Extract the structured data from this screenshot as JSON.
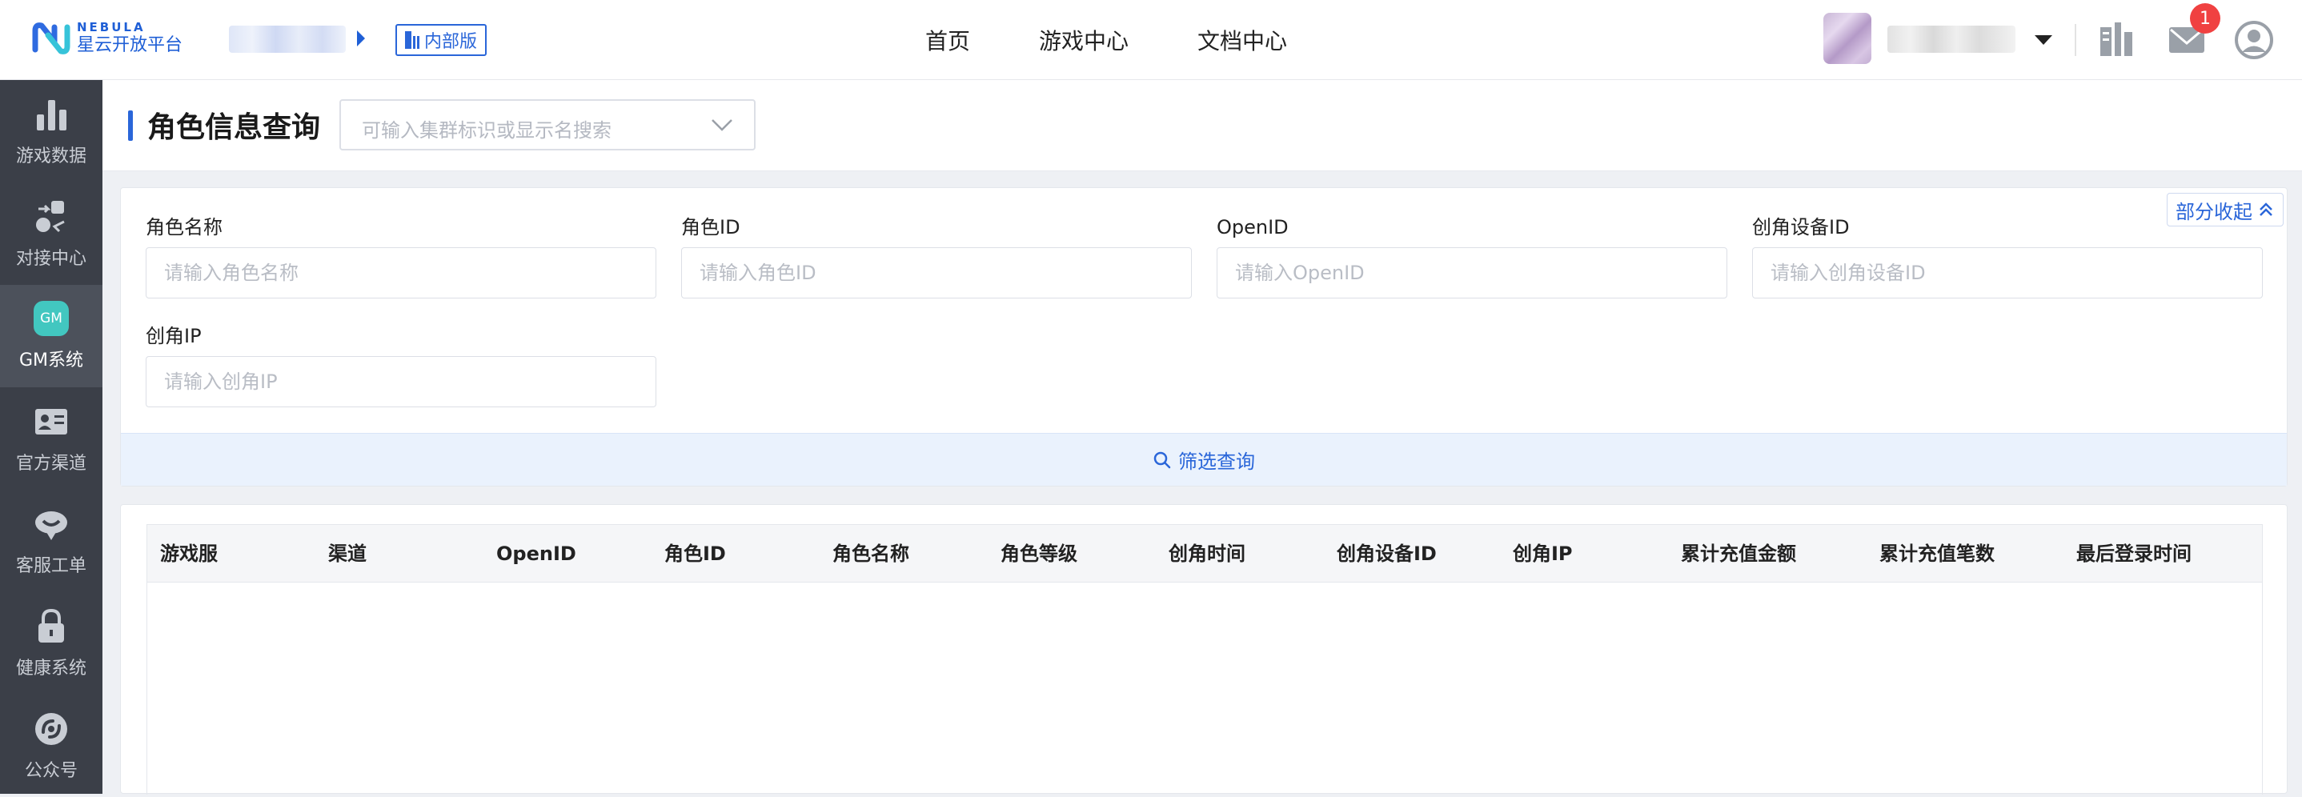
{
  "brand": {
    "en": "NEBULA",
    "cn": "星云开放平台"
  },
  "header": {
    "internal_badge": "内部版",
    "nav": [
      "首页",
      "游戏中心",
      "文档中心"
    ],
    "mail_count": "1"
  },
  "sidebar": {
    "items": [
      {
        "label": "游戏数据",
        "icon": "bar-chart-icon"
      },
      {
        "label": "对接中心",
        "icon": "integration-icon"
      },
      {
        "label": "GM系统",
        "icon": "gm-icon",
        "badge": "GM",
        "active": true
      },
      {
        "label": "官方渠道",
        "icon": "id-card-icon"
      },
      {
        "label": "客服工单",
        "icon": "support-icon"
      },
      {
        "label": "健康系统",
        "icon": "lock-icon"
      },
      {
        "label": "公众号",
        "icon": "wechat-icon"
      }
    ]
  },
  "page": {
    "title": "角色信息查询",
    "cluster_placeholder": "可输入集群标识或显示名搜索"
  },
  "filters": {
    "collapse_label": "部分收起",
    "fields": [
      {
        "label": "角色名称",
        "placeholder": "请输入角色名称"
      },
      {
        "label": "角色ID",
        "placeholder": "请输入角色ID"
      },
      {
        "label": "OpenID",
        "placeholder": "请输入OpenID"
      },
      {
        "label": "创角设备ID",
        "placeholder": "请输入创角设备ID"
      },
      {
        "label": "创角IP",
        "placeholder": "请输入创角IP"
      }
    ],
    "search_label": "筛选查询"
  },
  "table": {
    "columns": [
      "游戏服",
      "渠道",
      "OpenID",
      "角色ID",
      "角色名称",
      "角色等级",
      "创角时间",
      "创角设备ID",
      "创角IP",
      "累计充值金额",
      "累计充值笔数",
      "最后登录时间"
    ],
    "rows": []
  },
  "colors": {
    "accent": "#2a66d9",
    "sidebar_bg": "#3b3f48",
    "sidebar_active": "#4c515b",
    "badge_red": "#f04141",
    "gm_teal": "#42c7c0"
  }
}
